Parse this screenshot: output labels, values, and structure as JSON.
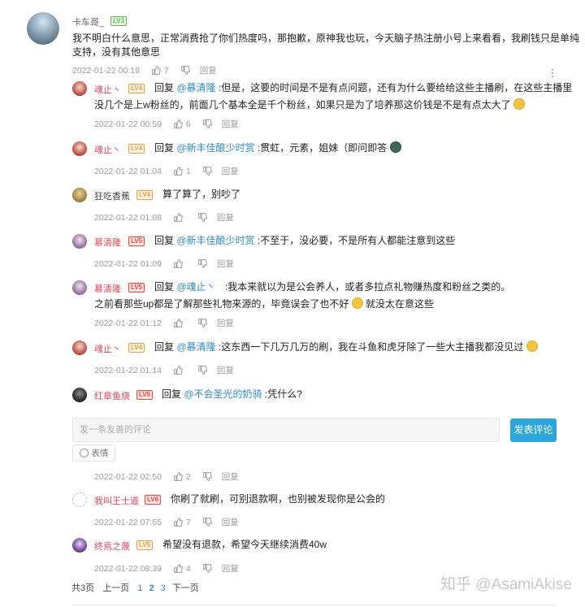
{
  "main_comment": {
    "username": "卡车哥_",
    "level": "LV3",
    "text_line1": "我不明白什么意思，正常消费抢了你们热度吗，那抱歉，原神我也玩，今天脑子热注册小号上来看看，我刷钱只是单纯",
    "text_line2": "支持，没有其他意思",
    "time": "2022-01-22 00:19",
    "likes": "7",
    "reply_label": "回复"
  },
  "replies": [
    {
      "username": "魂止丶",
      "level": "LV4",
      "prefix": "回复",
      "at": "@慕清隆",
      "text": ":但是，这要的时间是不是有点问题，还有为什么要给给这些主播刷，在这些主播里",
      "text2": "没几个是上w粉丝的，前面几个基本全是千个粉丝，如果只是为了培养那这价钱是不是有点太大了",
      "time": "2022-01-22 00:59",
      "likes": "6",
      "reply_label": "回复"
    },
    {
      "username": "魂止丶",
      "level": "LV4",
      "prefix": "回复",
      "at": "@新丰佳酿少时赏",
      "text": ":贯虹，元素，姐妹（即问即答",
      "time": "2022-01-22 01:04",
      "likes": "1",
      "reply_label": "回复"
    },
    {
      "username": "狂吃香蕉",
      "level": "LV4",
      "text": "算了算了，别吵了",
      "time": "2022-01-22 01:08",
      "likes": "",
      "reply_label": "回复"
    },
    {
      "username": "慕清隆",
      "level": "LV5",
      "prefix": "回复",
      "at": "@新丰佳酿少时赏",
      "text": ":不至于，没必要，不是所有人都能注意到这些",
      "time": "2022-01-22 01:09",
      "likes": "",
      "reply_label": "回复"
    },
    {
      "username": "慕清隆",
      "level": "LV5",
      "prefix": "回复",
      "at": "@魂止丶",
      "text": ":我本来就以为是公会养人，或者多拉点礼物赚热度和粉丝之类的。",
      "text2a": "之前看那些up都是了解那些礼物来源的，毕竟误会了也不好",
      "text2b": "就没太在意这些",
      "time": "2022-01-22 01:12",
      "likes": "",
      "reply_label": "回复"
    },
    {
      "username": "魂止丶",
      "level": "LV4",
      "prefix": "回复",
      "at": "@慕清隆",
      "text": ":这东西一下几万几万的刷，我在斗鱼和虎牙除了一些大主播我都没见过",
      "time": "2022-01-22 01:14",
      "likes": "",
      "reply_label": "回复"
    },
    {
      "username": "红章鱼烧",
      "level": "LV5",
      "prefix": "回复",
      "at": "@不会圣光的奶骑",
      "text": ":凭什么?"
    }
  ],
  "compose": {
    "placeholder": "发一条友善的评论",
    "submit": "发表评论",
    "emoji_label": "表情",
    "time": "2022-01-22 02:50",
    "likes": "2",
    "reply_label": "回复"
  },
  "later_replies": [
    {
      "username": "我叫王士道",
      "level": "LV6",
      "text": "你刷了就刷，可别退款啊，也别被发现你是公会的",
      "time": "2022-01-22 07:55",
      "likes": "7",
      "reply_label": "回复"
    },
    {
      "username": "终焉之蔑",
      "level": "LV5",
      "text": "希望没有退款，希望今天继续消费40w",
      "time": "2022-01-22 08:39",
      "likes": "4",
      "reply_label": "回复"
    }
  ],
  "pager": {
    "total": "共3页",
    "prev": "上一页",
    "p1": "1",
    "p2": "2",
    "p3": "3",
    "next": "下一页"
  },
  "watermark": "知乎 @AsamiAkise",
  "colors": {
    "accent": "#2da6dc",
    "link": "#2e8bc6",
    "name_red": "#e0455a"
  }
}
